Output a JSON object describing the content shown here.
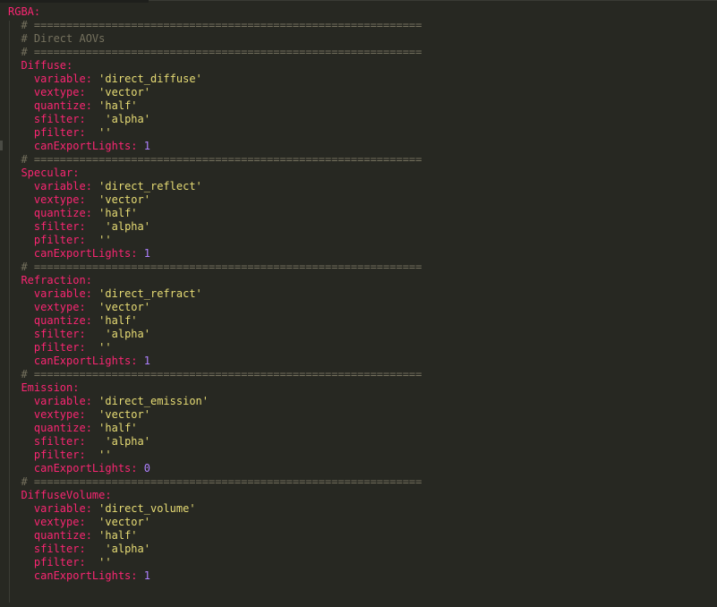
{
  "editor": {
    "language": "yaml",
    "theme": "monokai",
    "colors": {
      "background": "#272822",
      "key": "#f92672",
      "string": "#e6db74",
      "number": "#ae81ff",
      "comment": "#75715e",
      "plain": "#f8f8f2"
    },
    "lines": [
      {
        "indent": "",
        "tokens": [
          {
            "type": "key",
            "text": "RGBA:"
          }
        ]
      },
      {
        "indent": "  ",
        "tokens": [
          {
            "type": "comment",
            "text": "# ============================================================"
          }
        ]
      },
      {
        "indent": "  ",
        "tokens": [
          {
            "type": "comment",
            "text": "# Direct AOVs"
          }
        ]
      },
      {
        "indent": "  ",
        "tokens": [
          {
            "type": "comment",
            "text": "# ============================================================"
          }
        ]
      },
      {
        "indent": "  ",
        "tokens": [
          {
            "type": "key",
            "text": "Diffuse:"
          }
        ]
      },
      {
        "indent": "    ",
        "tokens": [
          {
            "type": "key",
            "text": "variable:"
          },
          {
            "type": "plain",
            "text": " "
          },
          {
            "type": "str",
            "text": "'direct_diffuse'"
          }
        ]
      },
      {
        "indent": "    ",
        "tokens": [
          {
            "type": "key",
            "text": "vextype:"
          },
          {
            "type": "plain",
            "text": "  "
          },
          {
            "type": "str",
            "text": "'vector'"
          }
        ]
      },
      {
        "indent": "    ",
        "tokens": [
          {
            "type": "key",
            "text": "quantize:"
          },
          {
            "type": "plain",
            "text": " "
          },
          {
            "type": "str",
            "text": "'half'"
          }
        ]
      },
      {
        "indent": "    ",
        "tokens": [
          {
            "type": "key",
            "text": "sfilter:"
          },
          {
            "type": "plain",
            "text": "   "
          },
          {
            "type": "str",
            "text": "'alpha'"
          }
        ]
      },
      {
        "indent": "    ",
        "tokens": [
          {
            "type": "key",
            "text": "pfilter:"
          },
          {
            "type": "plain",
            "text": "  "
          },
          {
            "type": "str",
            "text": "''"
          }
        ]
      },
      {
        "indent": "    ",
        "tokens": [
          {
            "type": "key",
            "text": "canExportLights:"
          },
          {
            "type": "plain",
            "text": " "
          },
          {
            "type": "num",
            "text": "1"
          }
        ]
      },
      {
        "indent": "  ",
        "tokens": [
          {
            "type": "comment",
            "text": "# ============================================================"
          }
        ]
      },
      {
        "indent": "  ",
        "tokens": [
          {
            "type": "key",
            "text": "Specular:"
          }
        ]
      },
      {
        "indent": "    ",
        "tokens": [
          {
            "type": "key",
            "text": "variable:"
          },
          {
            "type": "plain",
            "text": " "
          },
          {
            "type": "str",
            "text": "'direct_reflect'"
          }
        ]
      },
      {
        "indent": "    ",
        "tokens": [
          {
            "type": "key",
            "text": "vextype:"
          },
          {
            "type": "plain",
            "text": "  "
          },
          {
            "type": "str",
            "text": "'vector'"
          }
        ]
      },
      {
        "indent": "    ",
        "tokens": [
          {
            "type": "key",
            "text": "quantize:"
          },
          {
            "type": "plain",
            "text": " "
          },
          {
            "type": "str",
            "text": "'half'"
          }
        ]
      },
      {
        "indent": "    ",
        "tokens": [
          {
            "type": "key",
            "text": "sfilter:"
          },
          {
            "type": "plain",
            "text": "   "
          },
          {
            "type": "str",
            "text": "'alpha'"
          }
        ]
      },
      {
        "indent": "    ",
        "tokens": [
          {
            "type": "key",
            "text": "pfilter:"
          },
          {
            "type": "plain",
            "text": "  "
          },
          {
            "type": "str",
            "text": "''"
          }
        ]
      },
      {
        "indent": "    ",
        "tokens": [
          {
            "type": "key",
            "text": "canExportLights:"
          },
          {
            "type": "plain",
            "text": " "
          },
          {
            "type": "num",
            "text": "1"
          }
        ]
      },
      {
        "indent": "  ",
        "tokens": [
          {
            "type": "comment",
            "text": "# ============================================================"
          }
        ]
      },
      {
        "indent": "  ",
        "tokens": [
          {
            "type": "key",
            "text": "Refraction:"
          }
        ]
      },
      {
        "indent": "    ",
        "tokens": [
          {
            "type": "key",
            "text": "variable:"
          },
          {
            "type": "plain",
            "text": " "
          },
          {
            "type": "str",
            "text": "'direct_refract'"
          }
        ]
      },
      {
        "indent": "    ",
        "tokens": [
          {
            "type": "key",
            "text": "vextype:"
          },
          {
            "type": "plain",
            "text": "  "
          },
          {
            "type": "str",
            "text": "'vector'"
          }
        ]
      },
      {
        "indent": "    ",
        "tokens": [
          {
            "type": "key",
            "text": "quantize:"
          },
          {
            "type": "plain",
            "text": " "
          },
          {
            "type": "str",
            "text": "'half'"
          }
        ]
      },
      {
        "indent": "    ",
        "tokens": [
          {
            "type": "key",
            "text": "sfilter:"
          },
          {
            "type": "plain",
            "text": "   "
          },
          {
            "type": "str",
            "text": "'alpha'"
          }
        ]
      },
      {
        "indent": "    ",
        "tokens": [
          {
            "type": "key",
            "text": "pfilter:"
          },
          {
            "type": "plain",
            "text": "  "
          },
          {
            "type": "str",
            "text": "''"
          }
        ]
      },
      {
        "indent": "    ",
        "tokens": [
          {
            "type": "key",
            "text": "canExportLights:"
          },
          {
            "type": "plain",
            "text": " "
          },
          {
            "type": "num",
            "text": "1"
          }
        ]
      },
      {
        "indent": "  ",
        "tokens": [
          {
            "type": "comment",
            "text": "# ============================================================"
          }
        ]
      },
      {
        "indent": "  ",
        "tokens": [
          {
            "type": "key",
            "text": "Emission:"
          }
        ]
      },
      {
        "indent": "    ",
        "tokens": [
          {
            "type": "key",
            "text": "variable:"
          },
          {
            "type": "plain",
            "text": " "
          },
          {
            "type": "str",
            "text": "'direct_emission'"
          }
        ]
      },
      {
        "indent": "    ",
        "tokens": [
          {
            "type": "key",
            "text": "vextype:"
          },
          {
            "type": "plain",
            "text": "  "
          },
          {
            "type": "str",
            "text": "'vector'"
          }
        ]
      },
      {
        "indent": "    ",
        "tokens": [
          {
            "type": "key",
            "text": "quantize:"
          },
          {
            "type": "plain",
            "text": " "
          },
          {
            "type": "str",
            "text": "'half'"
          }
        ]
      },
      {
        "indent": "    ",
        "tokens": [
          {
            "type": "key",
            "text": "sfilter:"
          },
          {
            "type": "plain",
            "text": "   "
          },
          {
            "type": "str",
            "text": "'alpha'"
          }
        ]
      },
      {
        "indent": "    ",
        "tokens": [
          {
            "type": "key",
            "text": "pfilter:"
          },
          {
            "type": "plain",
            "text": "  "
          },
          {
            "type": "str",
            "text": "''"
          }
        ]
      },
      {
        "indent": "    ",
        "tokens": [
          {
            "type": "key",
            "text": "canExportLights:"
          },
          {
            "type": "plain",
            "text": " "
          },
          {
            "type": "num",
            "text": "0"
          }
        ]
      },
      {
        "indent": "  ",
        "tokens": [
          {
            "type": "comment",
            "text": "# ============================================================"
          }
        ]
      },
      {
        "indent": "  ",
        "tokens": [
          {
            "type": "key",
            "text": "DiffuseVolume:"
          }
        ]
      },
      {
        "indent": "    ",
        "tokens": [
          {
            "type": "key",
            "text": "variable:"
          },
          {
            "type": "plain",
            "text": " "
          },
          {
            "type": "str",
            "text": "'direct_volume'"
          }
        ]
      },
      {
        "indent": "    ",
        "tokens": [
          {
            "type": "key",
            "text": "vextype:"
          },
          {
            "type": "plain",
            "text": "  "
          },
          {
            "type": "str",
            "text": "'vector'"
          }
        ]
      },
      {
        "indent": "    ",
        "tokens": [
          {
            "type": "key",
            "text": "quantize:"
          },
          {
            "type": "plain",
            "text": " "
          },
          {
            "type": "str",
            "text": "'half'"
          }
        ]
      },
      {
        "indent": "    ",
        "tokens": [
          {
            "type": "key",
            "text": "sfilter:"
          },
          {
            "type": "plain",
            "text": "   "
          },
          {
            "type": "str",
            "text": "'alpha'"
          }
        ]
      },
      {
        "indent": "    ",
        "tokens": [
          {
            "type": "key",
            "text": "pfilter:"
          },
          {
            "type": "plain",
            "text": "  "
          },
          {
            "type": "str",
            "text": "''"
          }
        ]
      },
      {
        "indent": "    ",
        "tokens": [
          {
            "type": "key",
            "text": "canExportLights:"
          },
          {
            "type": "plain",
            "text": " "
          },
          {
            "type": "num",
            "text": "1"
          }
        ]
      }
    ]
  }
}
